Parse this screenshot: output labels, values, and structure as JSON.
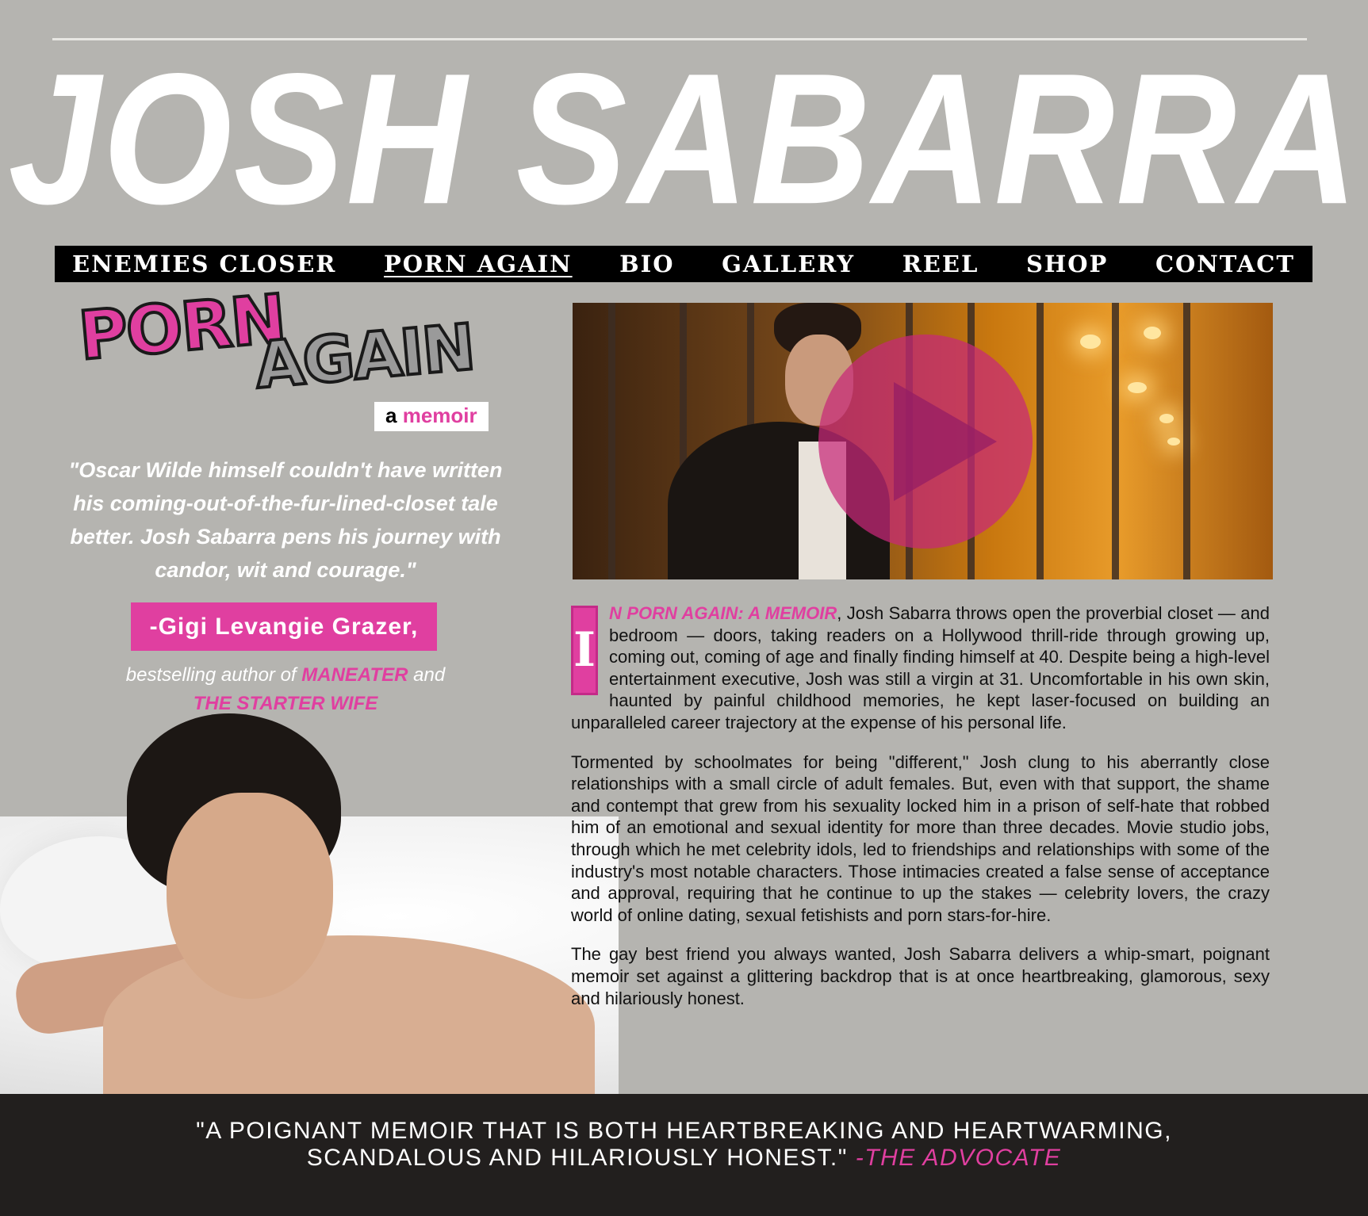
{
  "site": {
    "title": "JOSH SABARRA"
  },
  "nav": {
    "items": [
      {
        "label": "ENEMIES CLOSER"
      },
      {
        "label": "PORN AGAIN"
      },
      {
        "label": "BIO"
      },
      {
        "label": "GALLERY"
      },
      {
        "label": "REEL"
      },
      {
        "label": "SHOP"
      },
      {
        "label": "CONTACT"
      }
    ],
    "active_index": 1
  },
  "book": {
    "logo_word1": "PORN",
    "logo_word2": "AGAIN",
    "logo_a": "a",
    "logo_memoir": "memoir"
  },
  "quote": {
    "text": "\"Oscar Wilde himself couldn't have written his coming-out-of-the-fur-lined-closet tale better. Josh Sabarra pens his journey with candor, wit and courage.\"",
    "author": "-Gigi Levangie Grazer,",
    "sub_prefix": "bestselling author of ",
    "book1": "MANEATER",
    "sub_and": " and",
    "book2": "THE STARTER WIFE"
  },
  "video": {
    "play_icon": "play-icon"
  },
  "article": {
    "dropcap": "I",
    "lead": "N PORN AGAIN: A MEMOIR",
    "p1_rest": ", Josh Sabarra throws open the proverbial closet — and bedroom — doors, taking readers on a Hollywood thrill-ride through growing up, coming out, coming of age and finally finding himself at 40. Despite being a high-level entertainment executive, Josh was still a virgin at 31. Uncomfortable in his own skin, haunted by painful childhood memories, he kept laser-focused on building an unparalleled career trajectory at the expense of his personal life.",
    "p2": "Tormented by schoolmates for being \"different,\" Josh clung to his aberrantly close relationships with a small circle of adult females. But, even with that support, the shame and contempt that grew from his sexuality locked him in a prison of self-hate that robbed him of an emotional and sexual identity for more than three decades. Movie studio jobs, through which he met celebrity idols, led to friendships and relationships with some of the industry's most notable characters. Those intimacies created a false sense of acceptance and approval, requiring that he continue to up the stakes — celebrity lovers, the crazy world of online dating, sexual fetishists and porn stars-for-hire.",
    "p3": "The gay best friend you always wanted, Josh Sabarra delivers a whip-smart, poignant memoir set against a glittering backdrop that is at once heartbreaking, glamorous, sexy and hilariously honest."
  },
  "footer": {
    "line1": "\"A POIGNANT MEMOIR THAT IS BOTH HEARTBREAKING AND HEARTWARMING,",
    "line2": "SCANDALOUS AND HILARIOUSLY HONEST.\"",
    "cite": "-THE ADVOCATE"
  },
  "colors": {
    "background": "#b5b4b0",
    "accent_pink": "#e03fa0",
    "nav_bg": "#000000",
    "footer_bg": "#221f1e"
  }
}
